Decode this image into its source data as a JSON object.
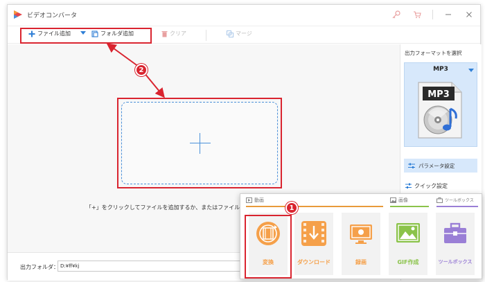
{
  "app": {
    "title": "ビデオコンバータ"
  },
  "toolbar": {
    "add_file": "ファイル追加",
    "add_folder": "フォルダ追加",
    "clear": "クリア",
    "merge": "マージ"
  },
  "main": {
    "hint": "「+」をクリックしてファイルを追加するか、またはファイル"
  },
  "bottom": {
    "output_label": "出力フォルダ：",
    "output_value": "D:¥ff¥kj"
  },
  "sidebar": {
    "title": "出力フォーマットを選択",
    "format": "MP3",
    "format_icon_text": "MP3",
    "param_label": "パラメータ設定",
    "quick_label": "クイック設定"
  },
  "popup": {
    "tab_video": "動画",
    "tab_image": "画像",
    "tab_tools": "ツールボックス",
    "tiles": [
      {
        "label": "変換",
        "icon": "film-convert-icon",
        "color": "#f5a04a"
      },
      {
        "label": "ダウンロード",
        "icon": "download-icon",
        "color": "#f5a04a"
      },
      {
        "label": "録画",
        "icon": "screen-record-icon",
        "color": "#f5a04a"
      },
      {
        "label": "GIF作成",
        "icon": "gif-image-icon",
        "color": "#8bc34a"
      },
      {
        "label": "ツールボックス",
        "icon": "toolbox-icon",
        "color": "#9a7fd6"
      }
    ]
  },
  "annotations": {
    "badge_1": "1",
    "badge_2": "2"
  },
  "colors": {
    "accent": "#4a90d9",
    "annotation": "#d9242f",
    "orange": "#f5a04a",
    "green": "#8bc34a",
    "purple": "#9a7fd6"
  }
}
